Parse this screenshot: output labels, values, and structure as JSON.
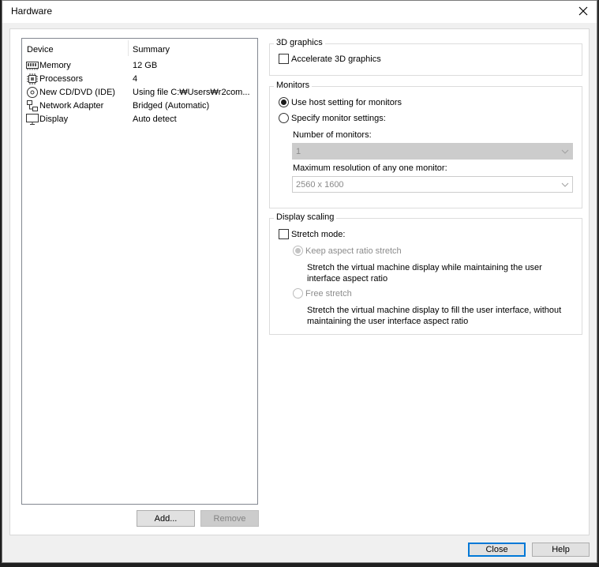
{
  "window": {
    "title": "Hardware"
  },
  "device_list": {
    "columns": [
      "Device",
      "Summary"
    ],
    "rows": [
      {
        "icon": "memory-icon",
        "device": "Memory",
        "summary": "12 GB"
      },
      {
        "icon": "processor-icon",
        "device": "Processors",
        "summary": "4"
      },
      {
        "icon": "cd-dvd-icon",
        "device": "New CD/DVD (IDE)",
        "summary": "Using file C:₩Users₩r2com..."
      },
      {
        "icon": "network-adapter-icon",
        "device": "Network Adapter",
        "summary": "Bridged (Automatic)"
      },
      {
        "icon": "display-icon",
        "device": "Display",
        "summary": "Auto detect"
      }
    ]
  },
  "buttons": {
    "add": "Add...",
    "remove": "Remove",
    "close": "Close",
    "help": "Help"
  },
  "graphics3d": {
    "title": "3D graphics",
    "accelerate": {
      "label": "Accelerate 3D graphics",
      "checked": false
    }
  },
  "monitors": {
    "title": "Monitors",
    "use_host": {
      "label": "Use host setting for monitors",
      "selected": true
    },
    "specify": {
      "label": "Specify monitor settings:",
      "selected": false
    },
    "num_label": "Number of monitors:",
    "num_value": "1",
    "maxres_label": "Maximum resolution of any one monitor:",
    "maxres_value": "2560 x 1600"
  },
  "scaling": {
    "title": "Display scaling",
    "stretch": {
      "label": "Stretch mode:",
      "checked": false
    },
    "keep_aspect": {
      "label": "Keep aspect ratio stretch",
      "desc1": "Stretch the virtual machine display while maintaining the user",
      "desc2": "interface aspect ratio"
    },
    "free": {
      "label": "Free stretch",
      "desc1": "Stretch the virtual machine display to fill the user interface, without",
      "desc2": "maintaining the user interface aspect ratio"
    }
  },
  "colors": {
    "accent": "#0078d7",
    "window_bg": "#f0f0f0",
    "panel_bg": "#ffffff"
  }
}
